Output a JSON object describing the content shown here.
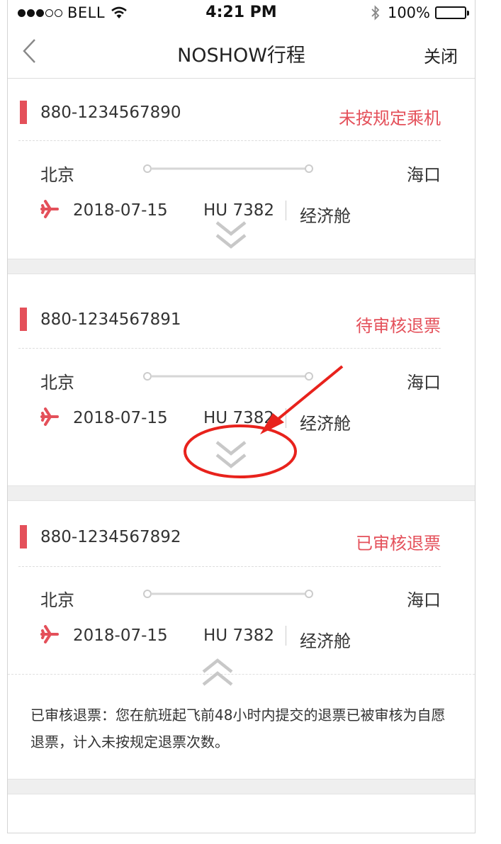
{
  "status_bar": {
    "carrier": "BELL",
    "time": "4:21 PM",
    "battery": "100%"
  },
  "nav": {
    "title": "NOSHOW行程",
    "close": "关闭"
  },
  "trips": [
    {
      "ticket": "880-1234567890",
      "status": "未按规定乘机",
      "from": "北京",
      "to": "海口",
      "date": "2018-07-15",
      "flight": "HU 7382",
      "cabin": "经济舱",
      "expanded": false
    },
    {
      "ticket": "880-1234567891",
      "status": "待审核退票",
      "from": "北京",
      "to": "海口",
      "date": "2018-07-15",
      "flight": "HU 7382",
      "cabin": "经济舱",
      "expanded": false
    },
    {
      "ticket": "880-1234567892",
      "status": "已审核退票",
      "from": "北京",
      "to": "海口",
      "date": "2018-07-15",
      "flight": "HU 7382",
      "cabin": "经济舱",
      "expanded": true
    }
  ],
  "note": "已审核退票：您在航班起飞前48小时内提交的退票已被审核为自愿退票，计入未按规定退票次数。",
  "colors": {
    "accent": "#e4505a",
    "annotation": "#e8221c",
    "divider": "#efefef"
  },
  "icons": [
    "back-arrow-icon",
    "wifi-icon",
    "bluetooth-icon",
    "battery-icon",
    "plane-icon",
    "chevron-down-icon",
    "chevron-up-icon"
  ]
}
